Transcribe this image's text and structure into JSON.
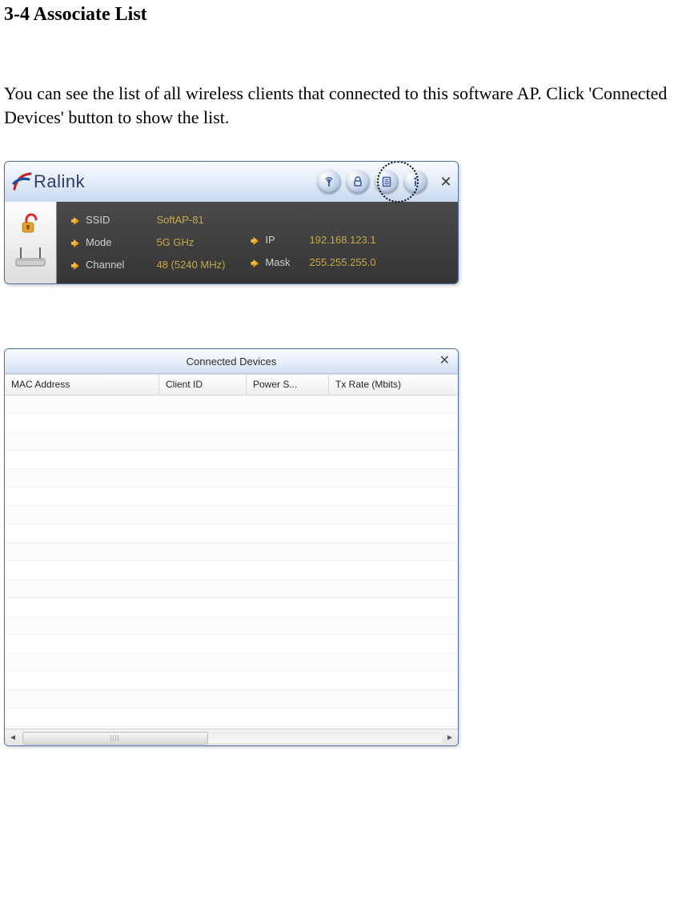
{
  "heading": "3-4 Associate List",
  "body_text": "You can see the list of all wireless clients that connected to this software AP. Click 'Connected Devices' button to show the list.",
  "ralink": {
    "brand": "Ralink",
    "fields": {
      "ssid_label": "SSID",
      "ssid_value": "SoftAP-81",
      "mode_label": "Mode",
      "mode_value": "5G GHz",
      "channel_label": "Channel",
      "channel_value": "48 (5240 MHz)",
      "ip_label": "IP",
      "ip_value": "192.168.123.1",
      "mask_label": "Mask",
      "mask_value": "255.255.255.0"
    }
  },
  "devices": {
    "title": "Connected Devices",
    "columns": {
      "mac": "MAC Address",
      "client_id": "Client ID",
      "power": "Power S...",
      "tx": "Tx Rate (Mbits)"
    },
    "rows": []
  }
}
